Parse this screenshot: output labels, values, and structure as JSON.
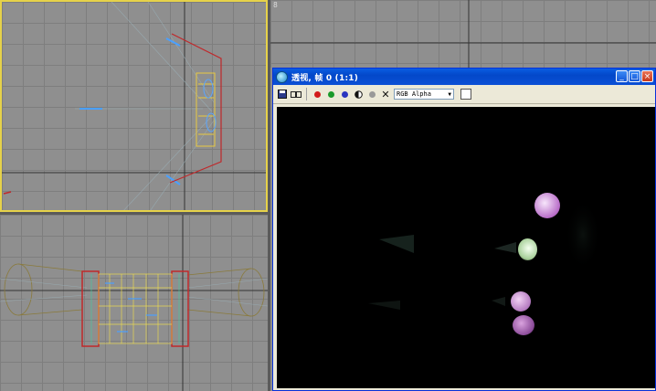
{
  "viewports": {
    "top_label": "",
    "front_label": "8",
    "left_label": ""
  },
  "render_window": {
    "title": "透视, 帧 0 (1:1)",
    "channel_select": "RGB Alpha",
    "window_buttons": {
      "minimize": "_",
      "maximize": "□",
      "close": "×"
    },
    "toolbar_icons": [
      "save-icon",
      "clone-icon",
      "red-channel-icon",
      "green-channel-icon",
      "blue-channel-icon",
      "alpha-channel-icon",
      "mono-icon",
      "clear-icon"
    ]
  },
  "colors": {
    "titlebar": "#0a5de3",
    "viewport_active_border": "#e6d24a",
    "render_background": "#000000"
  }
}
